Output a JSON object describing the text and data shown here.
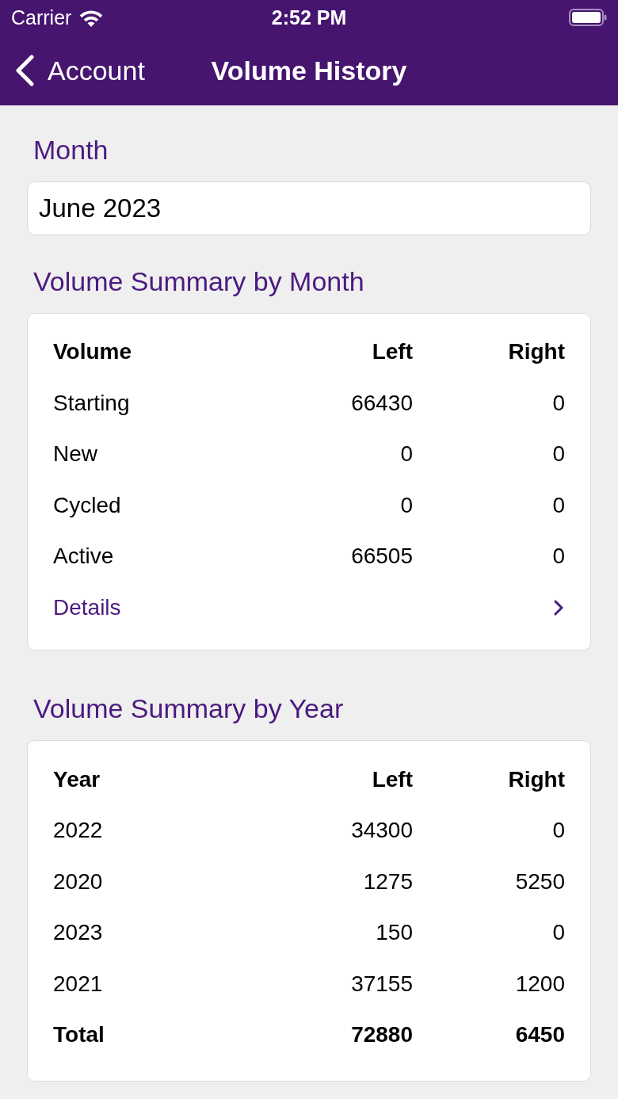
{
  "status_bar": {
    "carrier": "Carrier",
    "time": "2:52 PM"
  },
  "nav_bar": {
    "back_label": "Account",
    "title": "Volume History"
  },
  "month": {
    "label": "Month",
    "value": "June 2023"
  },
  "sections": [
    {
      "title": "Volume Summary by Month",
      "columns": [
        "Volume",
        "Left",
        "Right"
      ],
      "rows": [
        {
          "kind": "data",
          "cells": [
            "Starting",
            "66430",
            "0"
          ]
        },
        {
          "kind": "data",
          "cells": [
            "New",
            "0",
            "0"
          ]
        },
        {
          "kind": "data",
          "cells": [
            "Cycled",
            "0",
            "0"
          ]
        },
        {
          "kind": "data",
          "cells": [
            "Active",
            "66505",
            "0"
          ]
        }
      ],
      "link": {
        "label": "Details"
      }
    },
    {
      "title": "Volume Summary by Year",
      "columns": [
        "Year",
        "Left",
        "Right"
      ],
      "rows": [
        {
          "kind": "data",
          "cells": [
            "2022",
            "34300",
            "0"
          ]
        },
        {
          "kind": "data",
          "cells": [
            "2020",
            "1275",
            "5250"
          ]
        },
        {
          "kind": "data",
          "cells": [
            "2023",
            "150",
            "0"
          ]
        },
        {
          "kind": "data",
          "cells": [
            "2021",
            "37155",
            "1200"
          ]
        },
        {
          "kind": "total",
          "cells": [
            "Total",
            "72880",
            "6450"
          ]
        }
      ]
    }
  ]
}
